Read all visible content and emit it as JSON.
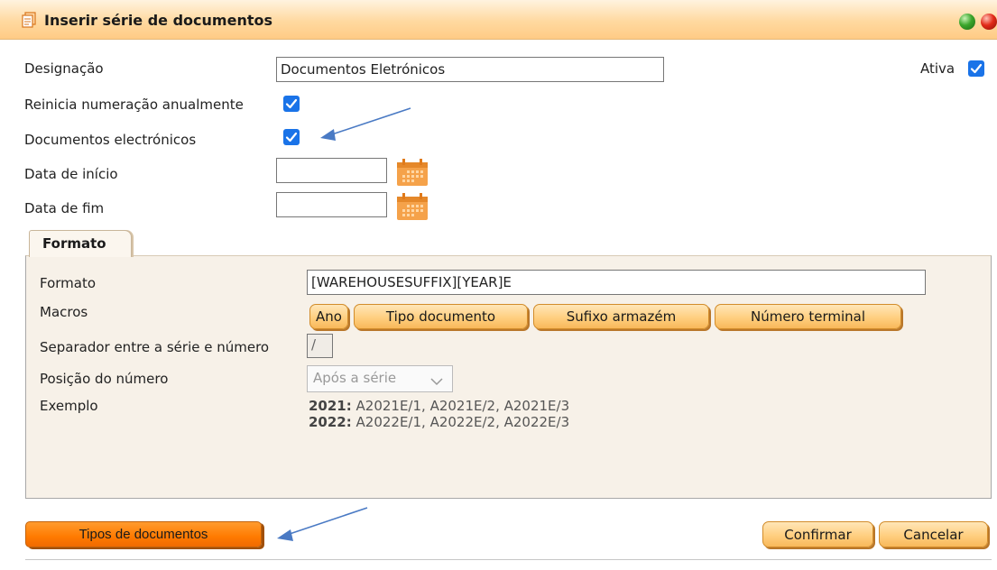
{
  "window": {
    "title": "Inserir série de documentos",
    "icon": "documents-icon",
    "controls": [
      "green-ball-icon",
      "red-ball-icon"
    ]
  },
  "form": {
    "designacao": {
      "label": "Designação",
      "value": "Documentos Eletrónicos"
    },
    "ativa": {
      "label": "Ativa",
      "checked": true
    },
    "reinicia": {
      "label": "Reinicia numeração anualmente",
      "checked": true
    },
    "doc_eletronicos": {
      "label": "Documentos electrónicos",
      "checked": true
    },
    "data_inicio": {
      "label": "Data de início",
      "value": "",
      "icon": "calendar-icon"
    },
    "data_fim": {
      "label": "Data de fim",
      "value": "",
      "icon": "calendar-icon"
    }
  },
  "tabs": [
    {
      "label": "Formato",
      "active": true
    }
  ],
  "formato_panel": {
    "formato": {
      "label": "Formato",
      "value": "[WAREHOUSESUFFIX][YEAR]E"
    },
    "macros": {
      "label": "Macros",
      "buttons": [
        "Ano",
        "Tipo documento",
        "Sufixo armazém",
        "Número terminal"
      ]
    },
    "separador": {
      "label": "Separador entre a série e número",
      "value": "/"
    },
    "posicao": {
      "label": "Posição do número",
      "selected": "Após a série"
    },
    "exemplo": {
      "label": "Exemplo",
      "lines": [
        {
          "year": "2021:",
          "text": " A2021E/1, A2021E/2, A2021E/3"
        },
        {
          "year": "2022:",
          "text": " A2022E/1, A2022E/2, A2022E/3"
        }
      ]
    }
  },
  "footer": {
    "tipos_label": "Tipos de documentos",
    "confirm_label": "Confirmar",
    "cancel_label": "Cancelar"
  },
  "colors": {
    "titlebar": "#ffcb85",
    "accent_orange": "#ff7a00",
    "checkbox_blue": "#1a73e8",
    "annotation_arrow": "#4a7ac4"
  }
}
